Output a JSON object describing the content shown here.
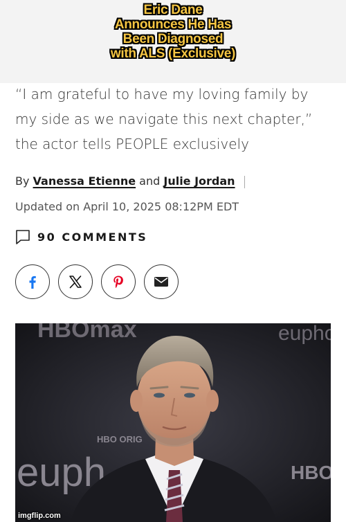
{
  "meme": {
    "title_lines": [
      "Eric Dane",
      "Announces He Has",
      "Been Diagnosed",
      "with ALS (Exclusive)"
    ]
  },
  "article": {
    "subtitle": "“I am grateful to have my loving family by my side as we navigate this next chapter,” the actor tells PEOPLE exclusively",
    "byline_prefix": "By",
    "author1": "Vanessa Etienne",
    "byline_joiner": "and",
    "author2": "Julie Jordan",
    "updated": "Updated on April 10, 2025 08:12PM EDT",
    "comments_label": "90 COMMENTS"
  },
  "share": {
    "buttons": [
      {
        "icon": "facebook-icon",
        "color": "#1877f2"
      },
      {
        "icon": "x-icon",
        "color": "#111111"
      },
      {
        "icon": "pinterest-icon",
        "color": "#e60023"
      },
      {
        "icon": "email-icon",
        "color": "#222222"
      }
    ]
  },
  "photo": {
    "backdrop_text_top": "HBOmax",
    "backdrop_text_top_right": "eupho",
    "backdrop_text_mid": "HBO ORIG",
    "backdrop_text_bottom_left": "euph",
    "backdrop_text_bottom_right": "HBO"
  },
  "watermark": "imgflip.com"
}
